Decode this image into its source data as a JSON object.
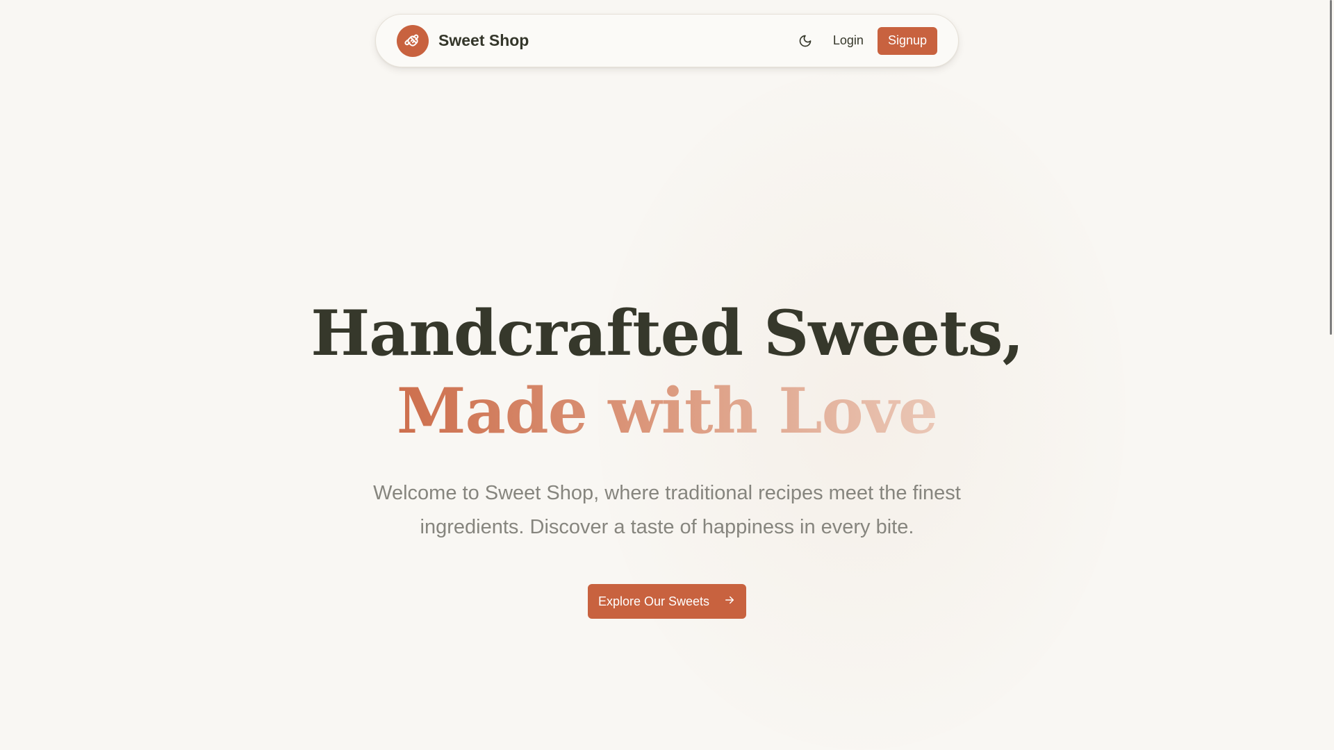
{
  "header": {
    "brand_name": "Sweet Shop",
    "logo_icon": "candy-icon",
    "theme_toggle_icon": "moon-icon",
    "login_label": "Login",
    "signup_label": "Signup"
  },
  "hero": {
    "headline_line1": "Handcrafted Sweets,",
    "headline_line2": "Made with Love",
    "subtitle": "Welcome to Sweet Shop, where traditional recipes meet the finest ingredients. Discover a taste of happiness in every bite.",
    "cta_label": "Explore Our Sweets",
    "cta_icon": "arrow-right-icon"
  },
  "colors": {
    "accent": "#c8623f",
    "text_dark": "#36382b",
    "text_muted": "#86857e",
    "background": "#f9f7f3"
  }
}
